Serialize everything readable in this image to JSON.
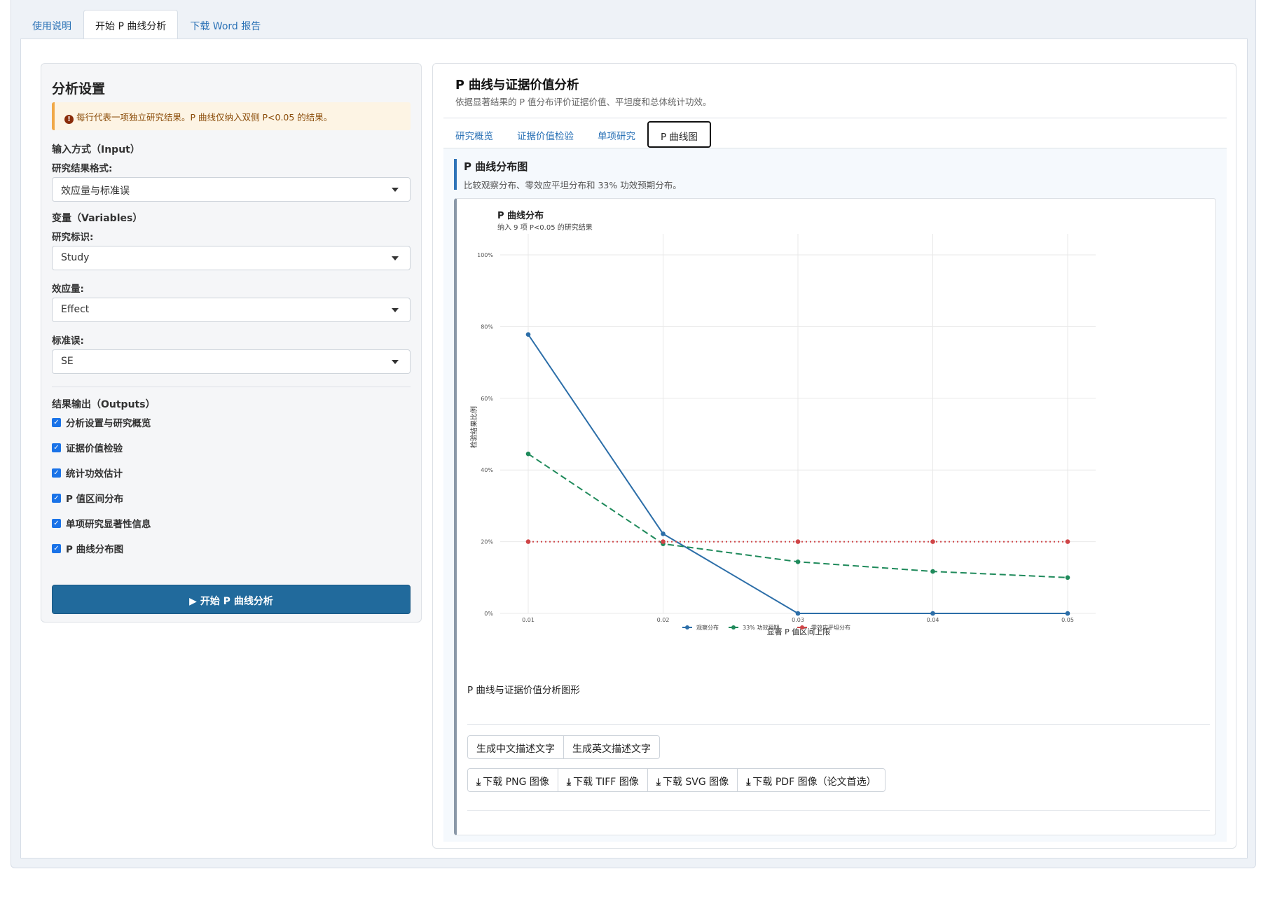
{
  "top_tabs": [
    {
      "label": "使用说明"
    },
    {
      "label": "开始 P 曲线分析"
    },
    {
      "label": "下载 Word 报告"
    }
  ],
  "sidebar": {
    "title": "分析设置",
    "alert": "每行代表一项独立研究结果。P 曲线仅纳入双侧 P<0.05 的结果。",
    "input_section": "输入方式（Input）",
    "format_label": "研究结果格式:",
    "format_value": "效应量与标准误",
    "variables_section": "变量（Variables）",
    "study_label": "研究标识:",
    "study_value": "Study",
    "effect_label": "效应量:",
    "effect_value": "Effect",
    "se_label": "标准误:",
    "se_value": "SE",
    "outputs_section": "结果输出（Outputs）",
    "outputs": [
      {
        "label": "分析设置与研究概览",
        "checked": true
      },
      {
        "label": "证据价值检验",
        "checked": true
      },
      {
        "label": "统计功效估计",
        "checked": true
      },
      {
        "label": "P 值区间分布",
        "checked": true
      },
      {
        "label": "单项研究显著性信息",
        "checked": true
      },
      {
        "label": "P 曲线分布图",
        "checked": true
      }
    ],
    "run_button": "开始 P 曲线分析"
  },
  "main": {
    "title": "P 曲线与证据价值分析",
    "subtitle": "依据显著结果的 P 值分布评价证据价值、平坦度和总体统计功效。",
    "subtabs": [
      {
        "label": "研究概览"
      },
      {
        "label": "证据价值检验"
      },
      {
        "label": "单项研究"
      },
      {
        "label": "P 曲线图"
      }
    ],
    "plot_title": "P 曲线分布图",
    "plot_subtitle": "比较观察分布、零效应平坦分布和 33% 功效预期分布。",
    "description": "P 曲线与证据价值分析图形",
    "text_buttons": [
      "生成中文描述文字",
      "生成英文描述文字"
    ],
    "download_buttons": [
      "下载 PNG 图像",
      "下载 TIFF 图像",
      "下载 SVG 图像",
      "下载 PDF 图像（论文首选）"
    ]
  },
  "chart_data": {
    "type": "line",
    "title": "P 曲线分布",
    "subtitle": "纳入 9 项 P<0.05 的研究结果",
    "xlabel": "显著 P 值区间上限",
    "ylabel": "检验结果比例",
    "x": [
      0.01,
      0.02,
      0.03,
      0.04,
      0.05
    ],
    "x_tick_labels": [
      "0.01",
      "0.02",
      "0.03",
      "0.04",
      "0.05"
    ],
    "y_tick_labels": [
      "0%",
      "20%",
      "40%",
      "60%",
      "80%",
      "100%"
    ],
    "ylim": [
      0,
      100
    ],
    "grid": true,
    "legend_position": "bottom",
    "series": [
      {
        "name": "观察分布",
        "values": [
          77.8,
          22.2,
          0,
          0,
          0
        ],
        "color": "#2c6ea8",
        "dash": "solid"
      },
      {
        "name": "33% 功效预期",
        "values": [
          44.5,
          19.4,
          14.4,
          11.7,
          10.0
        ],
        "color": "#1f8a5b",
        "dash": "dashed"
      },
      {
        "name": "零效应平坦分布",
        "values": [
          20,
          20,
          20,
          20,
          20
        ],
        "color": "#cf4547",
        "dash": "dotted"
      }
    ]
  }
}
